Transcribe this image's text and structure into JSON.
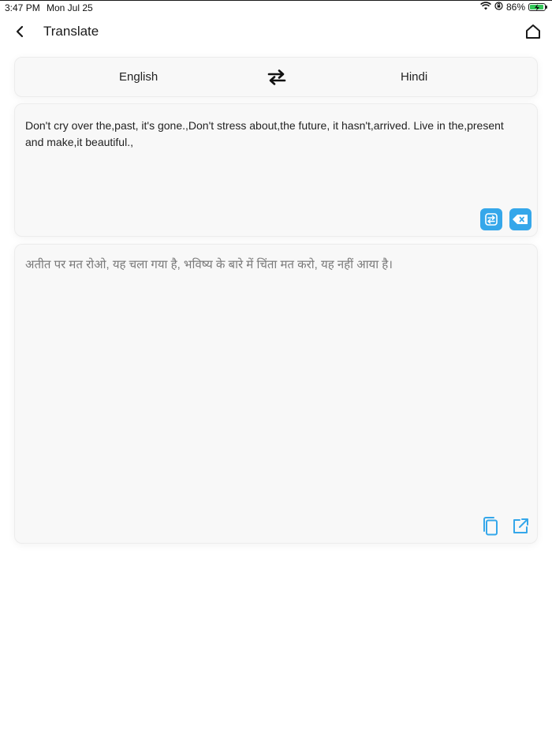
{
  "status": {
    "time": "3:47 PM",
    "date": "Mon Jul 25",
    "battery": "86%",
    "battery_level": 0.86
  },
  "nav": {
    "title": "Translate"
  },
  "languages": {
    "source": "English",
    "target": "Hindi"
  },
  "input": {
    "text": "Don't cry over the,past, it's gone.,Don't stress about,the future, it hasn't,arrived. Live in the,present and make,it beautiful.,"
  },
  "output": {
    "text": "अतीत पर मत रोओ, यह चला गया है, भविष्य के बारे में चिंता मत करो, यह नहीं आया है।"
  },
  "colors": {
    "accent": "#35a7ea",
    "card_bg": "#f8f8f8"
  },
  "icons": [
    "back-chevron-icon",
    "home-icon",
    "swap-arrows-icon",
    "swap-text-icon",
    "clear-icon",
    "copy-icon",
    "share-icon",
    "wifi-icon",
    "orientation-lock-icon",
    "battery-icon"
  ]
}
